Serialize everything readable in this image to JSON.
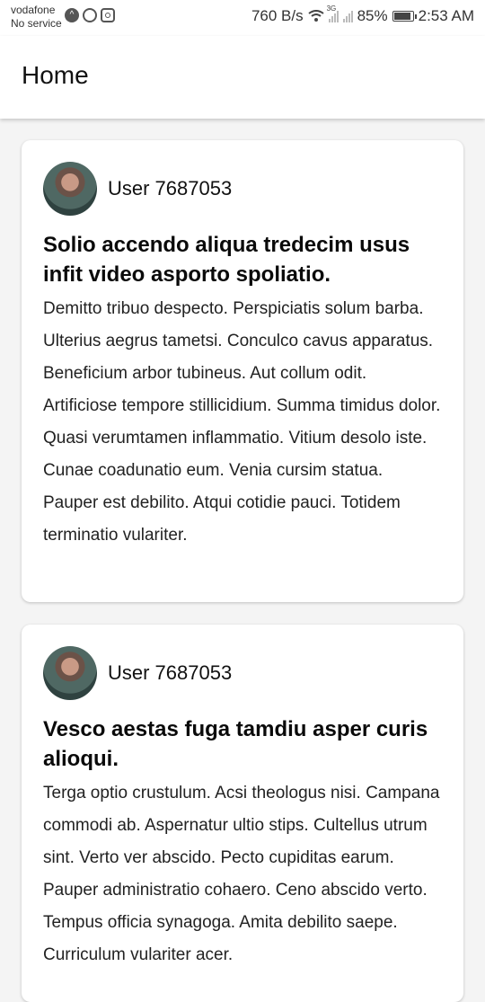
{
  "status_bar": {
    "carrier": "vodafone",
    "carrier_sub": "No service",
    "speed": "760 B/s",
    "network": "3G",
    "battery": "85%",
    "time": "2:53 AM"
  },
  "app_bar": {
    "title": "Home"
  },
  "posts": [
    {
      "author": "User 7687053",
      "title": "Solio accendo aliqua tredecim usus infit video asporto spoliatio.",
      "body": "Demitto tribuo despecto. Perspiciatis solum barba. Ulterius aegrus tametsi. Conculco cavus apparatus. Beneficium arbor tubineus. Aut collum odit. Artificiose tempore stillicidium. Summa timidus dolor. Quasi verumtamen inflammatio. Vitium desolo iste. Cunae coadunatio eum. Venia cursim statua. Pauper est debilito. Atqui cotidie pauci. Totidem terminatio vulariter."
    },
    {
      "author": "User 7687053",
      "title": "Vesco aestas fuga tamdiu asper curis alioqui.",
      "body": "Terga optio crustulum. Acsi theologus nisi. Campana commodi ab. Aspernatur ultio stips. Cultellus utrum sint. Verto ver abscido. Pecto cupiditas earum. Pauper administratio cohaero. Ceno abscido verto. Tempus officia synagoga. Amita debilito saepe. Curriculum vulariter acer."
    }
  ]
}
